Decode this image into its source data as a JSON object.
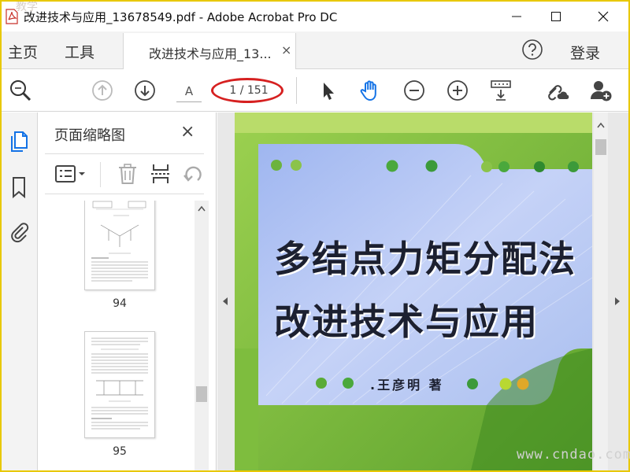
{
  "window": {
    "title": "改进技术与应用_13678549.pdf - Adobe Acrobat Pro DC",
    "corner_mark": "教学"
  },
  "menu": {
    "home": "主页",
    "tools": "工具",
    "login": "登录"
  },
  "tab": {
    "label": "改进技术与应用_13...",
    "close": "×"
  },
  "toolbar": {
    "page_input_value": "A",
    "page_total": "1 / 151"
  },
  "thumbnail_panel": {
    "title": "页面缩略图",
    "close": "×",
    "thumbnails": [
      {
        "page": "94"
      },
      {
        "page": "95"
      }
    ]
  },
  "document": {
    "cover": {
      "title_line1": "多结点力矩分配法",
      "title_line2": "改进技术与应用",
      "author": "王彦明 著",
      "author_dot": "."
    }
  },
  "watermark": "www.cndao.com",
  "colors": {
    "accent_blue": "#1473e6",
    "highlight_ring": "#d62020",
    "cover_green": "#88c24a",
    "cover_blue": "#b8c8f4"
  },
  "icons": {
    "app": "acrobat-pdf-icon",
    "search": "search-zoom-icon",
    "prev_page": "arrow-up-circle-icon",
    "next_page": "arrow-down-circle-icon",
    "select": "pointer-arrow-icon",
    "hand": "hand-icon",
    "zoom_out": "minus-circle-icon",
    "zoom_in": "plus-circle-icon",
    "read_mode": "keyboard-down-icon",
    "share_link": "link-cloud-icon",
    "add_user": "add-user-icon"
  }
}
